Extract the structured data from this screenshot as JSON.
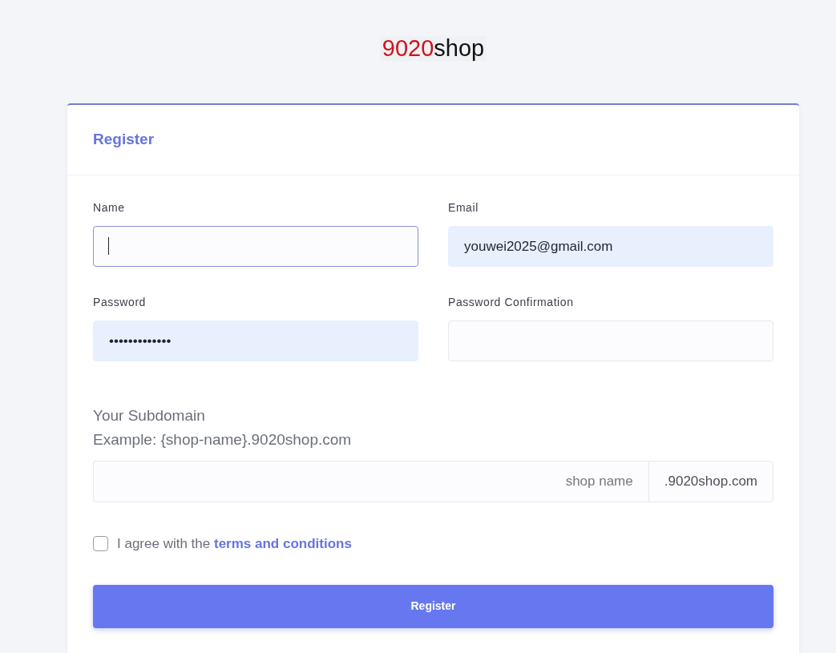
{
  "logo": {
    "number": "9020",
    "word": "shop"
  },
  "form": {
    "title": "Register",
    "fields": [
      {
        "label": "Name",
        "focused": true,
        "autofilled": false
      },
      {
        "label": "Email",
        "value": "youwei2025@gmail.com",
        "focused": false,
        "autofilled": true
      },
      {
        "label": "Password",
        "value": "•••••••••••••",
        "focused": false,
        "autofilled": true
      },
      {
        "label": "Password Confirmation",
        "focused": false,
        "autofilled": false
      }
    ],
    "subdomain": {
      "heading": "Your Subdomain",
      "example": "Example: {shop-name}.9020shop.com",
      "placeholder": "shop name",
      "suffix": ".9020shop.com"
    },
    "agree": {
      "checked": false,
      "text": "I agree with the",
      "link": "terms and conditions"
    },
    "submit": "Register"
  }
}
